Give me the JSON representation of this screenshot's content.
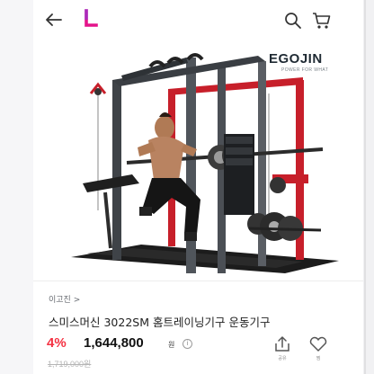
{
  "header": {
    "back_icon": "arrow-left-icon",
    "logo_letter": "L",
    "logo_color": "#e4138a",
    "search_icon": "search-icon",
    "cart_icon": "cart-icon"
  },
  "product_image": {
    "brand": "EGOJIN",
    "brand_tagline": "POWER FOR WHAT",
    "machine_frame_color": "#c71f2a"
  },
  "product": {
    "seller": "이고진 >",
    "title": "스미스머신 3022SM 홈트레이닝기구 운동기구",
    "discount": "4%",
    "price": "1,644,800",
    "price_unit": "원",
    "original_price": "1,719,000원"
  },
  "actions": {
    "share_label": "공유",
    "like_label": "찜"
  },
  "colors": {
    "accent_discount": "#f43142",
    "text_primary": "#222222"
  }
}
